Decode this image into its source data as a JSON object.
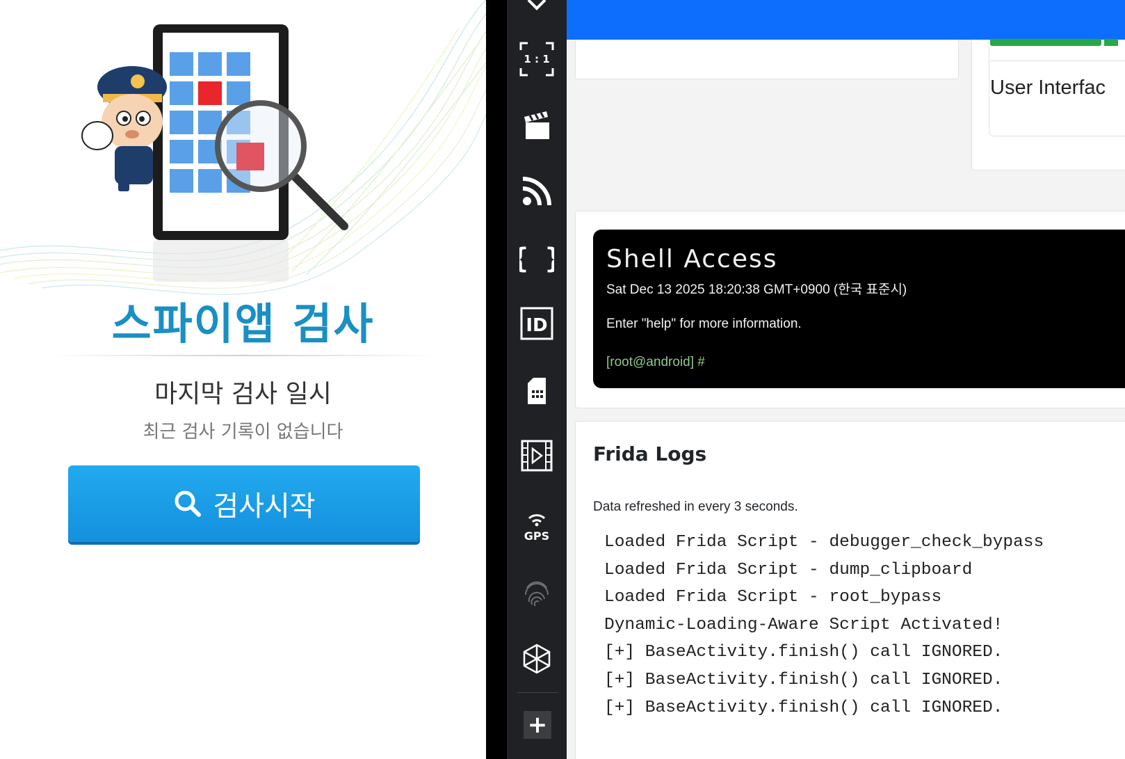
{
  "app": {
    "title": "스파이앱 검사",
    "last_scan_label": "마지막 검사 일시",
    "last_scan_value": "최근 검사 기록이 없습니다",
    "start_button_label": "검사시작"
  },
  "toolbar": {
    "aspect_label": "1 : 1",
    "gps_label": "GPS",
    "items": [
      "chevron-down-icon",
      "fullscreen-icon",
      "clapperboard-icon",
      "rss-icon",
      "braces-icon",
      "id-icon",
      "sim-card-icon",
      "film-icon",
      "gps-icon",
      "fingerprint-icon",
      "3d-box-icon"
    ],
    "add_label": "+"
  },
  "web": {
    "topbar_color": "#0d6efd",
    "ui_label": "User Interfac",
    "shell": {
      "title": "Shell Access",
      "date": "Sat Dec 13 2025 18:20:38 GMT+0900 (한국 표준시)",
      "help": "Enter \"help\" for more information.",
      "prompt": "[root@android] #"
    },
    "frida": {
      "title": "Frida Logs",
      "subtitle": "Data refreshed in every 3 seconds.",
      "lines": [
        "Loaded Frida Script - debugger_check_bypass",
        "Loaded Frida Script - dump_clipboard",
        "Loaded Frida Script - root_bypass",
        "Dynamic-Loading-Aware Script Activated!",
        "[+] BaseActivity.finish() call IGNORED.",
        "[+] BaseActivity.finish() call IGNORED.",
        "[+] BaseActivity.finish() call IGNORED."
      ]
    }
  }
}
